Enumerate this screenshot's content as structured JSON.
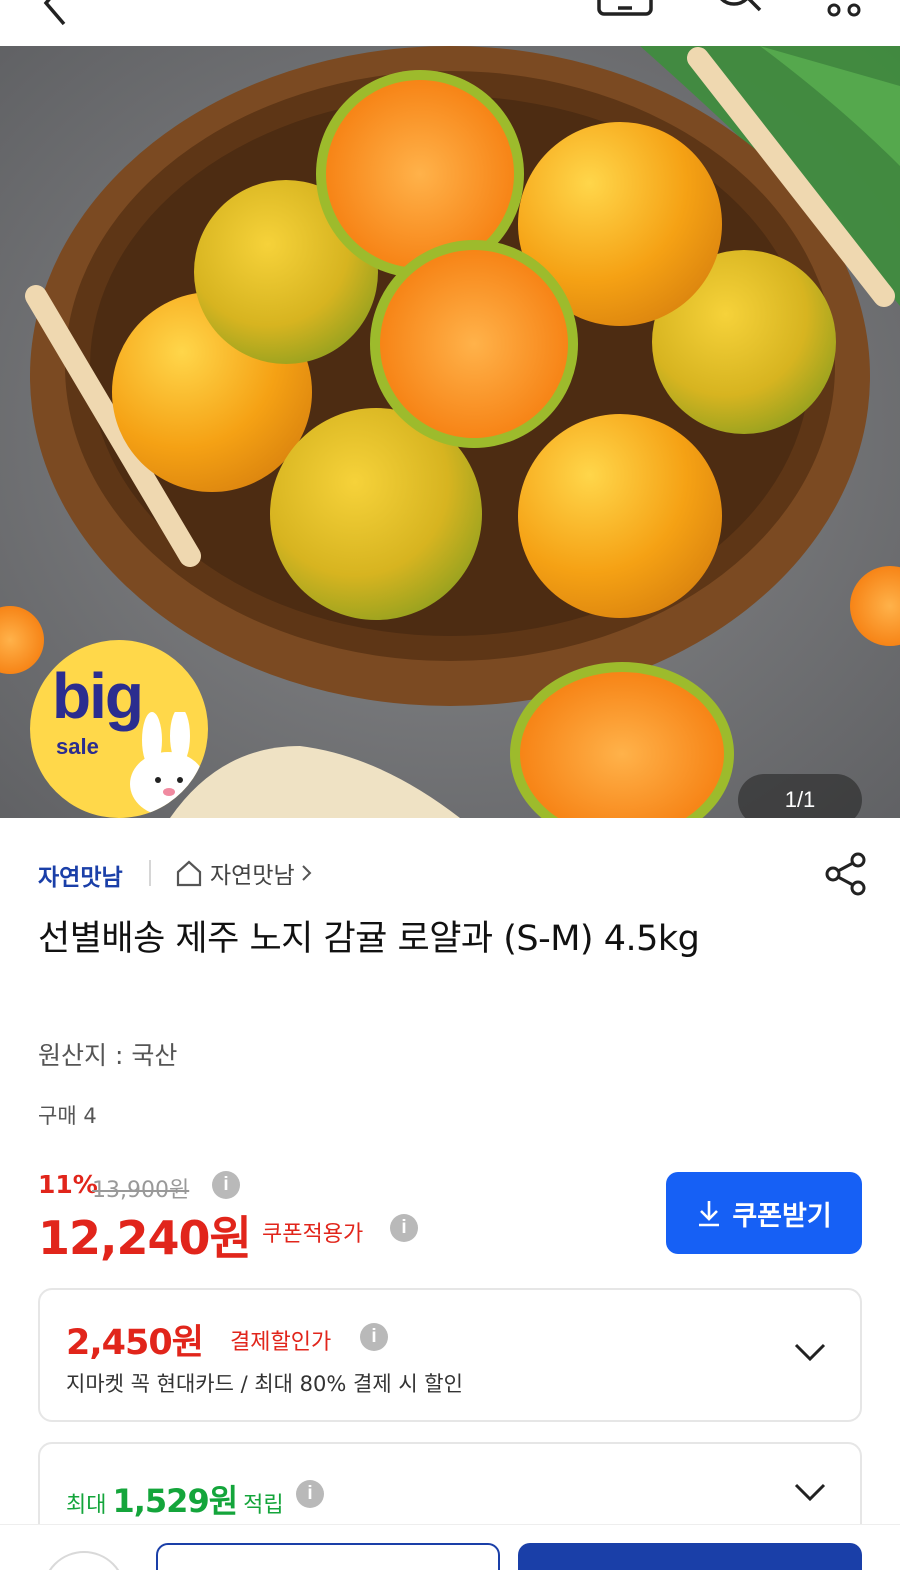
{
  "header": {
    "icons": [
      "back-icon",
      "cart-icon",
      "search-icon",
      "more-icon"
    ]
  },
  "hero": {
    "counter": "1/1",
    "badge": {
      "line1": "big",
      "line2": "sale"
    }
  },
  "product": {
    "seller_name": "자연맛남",
    "store_link": "자연맛남",
    "title": "선별배송 제주 노지 감귤 로얄과 (S-M) 4.5kg",
    "origin": "원산지 : 국산",
    "purchases": "구매 4"
  },
  "price": {
    "discount": "11%",
    "original": "13,900원",
    "sale": "12,240원",
    "sale_label": "쿠폰적용가",
    "coupon_button": "쿠폰받기"
  },
  "payment_discount": {
    "amount": "2,450원",
    "label": "결제할인가",
    "description": "지마켓 꼭 현대카드 / 최대 80% 결제 시 할인"
  },
  "points": {
    "prefix": "최대",
    "amount": "1,529원",
    "suffix": "적립"
  },
  "colors": {
    "accent_blue": "#1660f5",
    "navy": "#1a3fa8",
    "price_red": "#e1251b",
    "points_green": "#14a53b",
    "badge_yellow": "#ffd84a"
  }
}
